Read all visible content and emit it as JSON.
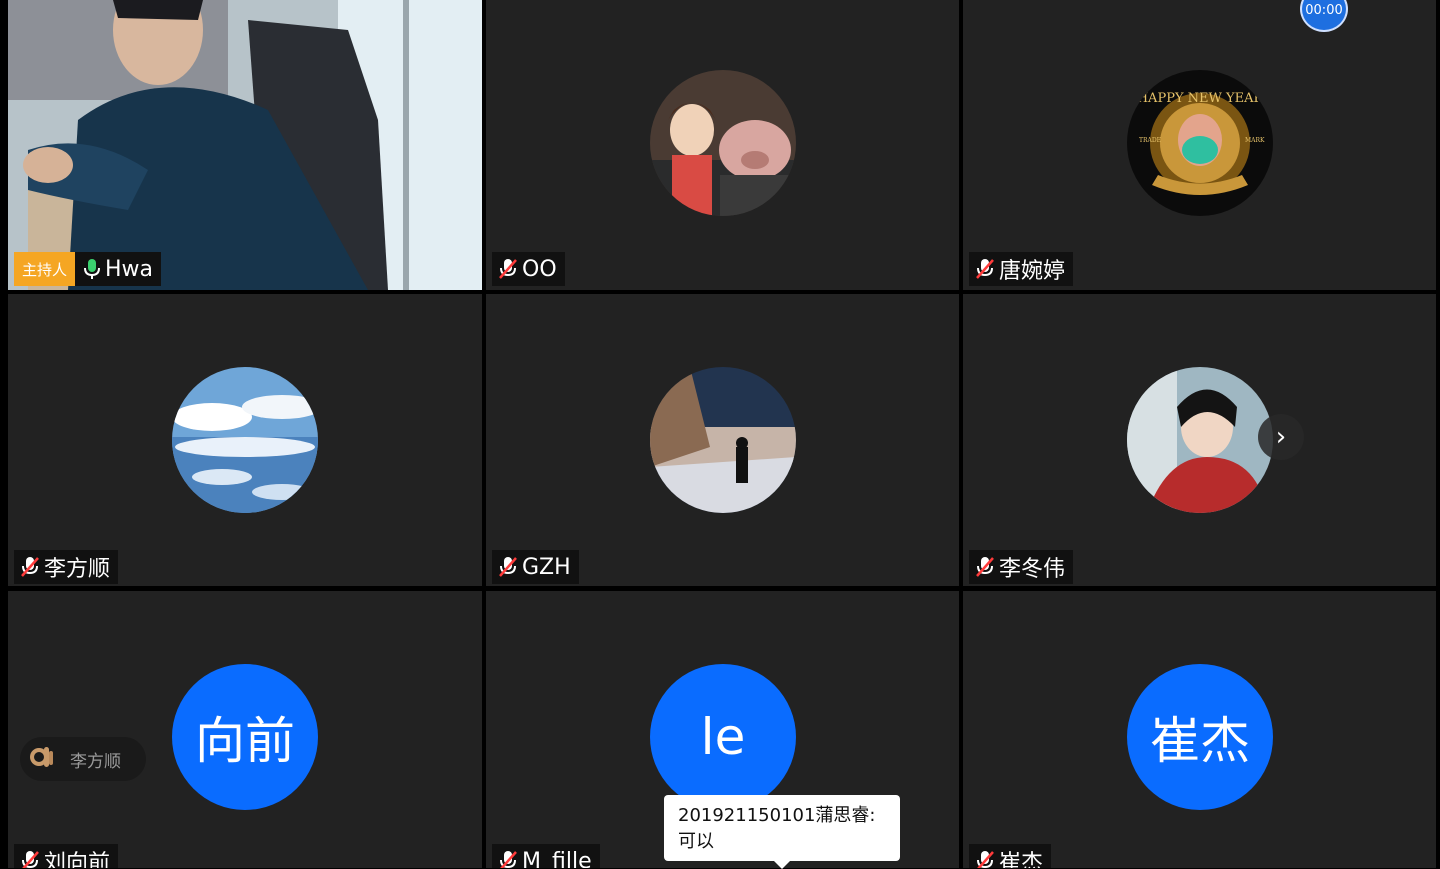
{
  "timer": "00:00",
  "host_label": "主持人",
  "participants": [
    {
      "name": "Hwa",
      "is_host": true,
      "muted": false
    },
    {
      "name": "OO",
      "muted": true
    },
    {
      "name": "唐婉婷",
      "muted": true
    },
    {
      "name": "李方顺",
      "muted": true
    },
    {
      "name": "GZH",
      "muted": true
    },
    {
      "name": "李冬伟",
      "muted": true
    },
    {
      "name": "刘向前",
      "muted": true,
      "avatar_text": "向前"
    },
    {
      "name": "M_fille",
      "muted": true,
      "avatar_text": "le"
    },
    {
      "name": "崔杰",
      "muted": true,
      "avatar_text": "崔杰"
    }
  ],
  "reaction": {
    "icon": "ok-hand-icon",
    "name": "李方顺"
  },
  "chat_popup": {
    "sender": "201921150101蒲思睿:",
    "message": "可以"
  },
  "colors": {
    "tile_bg": "#222222",
    "avatar_blue": "#0a6cff",
    "host_badge": "#f5a623"
  }
}
